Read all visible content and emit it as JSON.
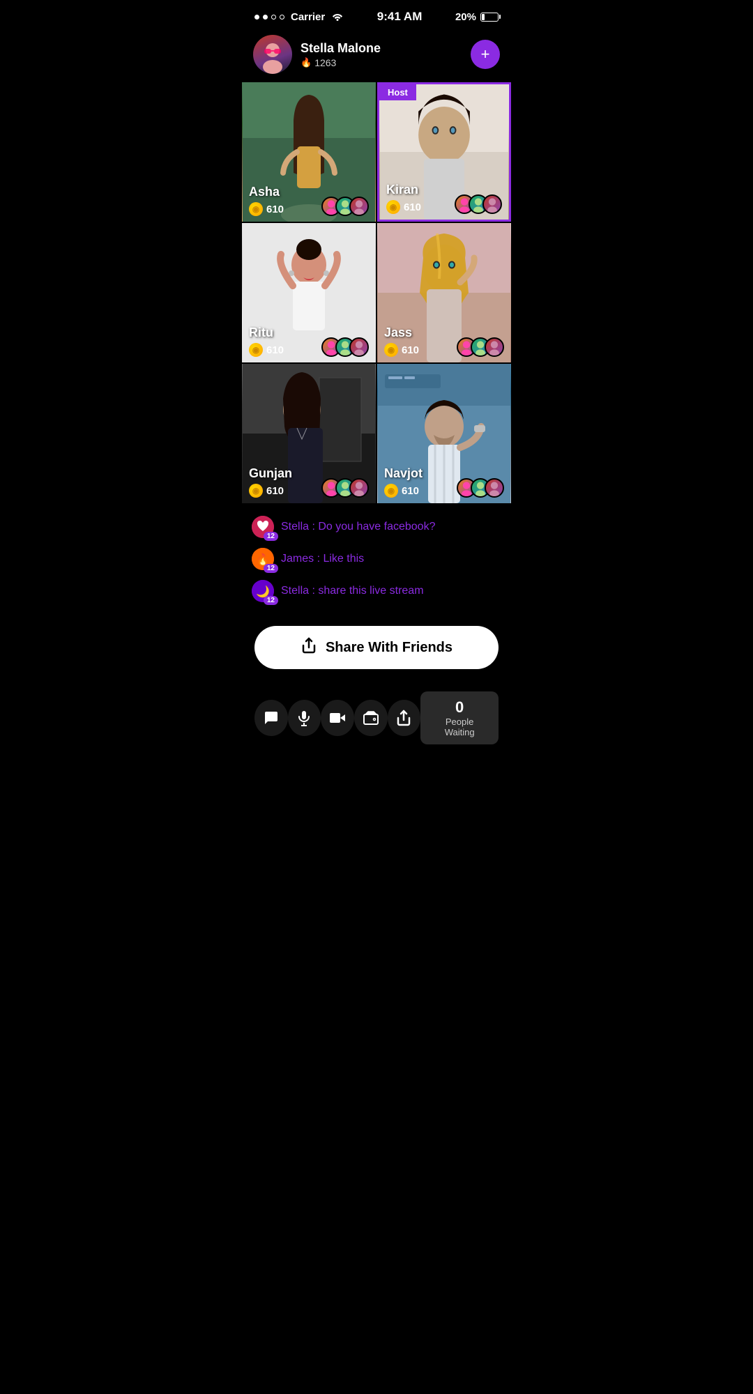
{
  "statusBar": {
    "time": "9:41 AM",
    "carrier": "Carrier",
    "battery": "20%"
  },
  "profile": {
    "name": "Stella Malone",
    "score": "1263",
    "addLabel": "+"
  },
  "grid": [
    {
      "id": "asha",
      "name": "Asha",
      "coins": "610",
      "isHost": false,
      "bgClass": "bg-asha"
    },
    {
      "id": "kiran",
      "name": "Kiran",
      "coins": "610",
      "isHost": true,
      "bgClass": "bg-kiran"
    },
    {
      "id": "ritu",
      "name": "Ritu",
      "coins": "610",
      "isHost": false,
      "bgClass": "bg-ritu"
    },
    {
      "id": "jass",
      "name": "Jass",
      "coins": "610",
      "isHost": false,
      "bgClass": "bg-jass"
    },
    {
      "id": "gunjan",
      "name": "Gunjan",
      "coins": "610",
      "isHost": false,
      "bgClass": "bg-gunjan"
    },
    {
      "id": "navjot",
      "name": "Navjot",
      "coins": "610",
      "isHost": false,
      "bgClass": "bg-navjot"
    }
  ],
  "hostLabel": "Host",
  "chat": [
    {
      "user": "Stella",
      "message": "Do you have facebook?",
      "avatarType": "heart",
      "badge": "12"
    },
    {
      "user": "James",
      "message": "Like this",
      "avatarType": "fire",
      "badge": "12"
    },
    {
      "user": "Stella",
      "message": "share this live stream",
      "avatarType": "moon",
      "badge": "12"
    }
  ],
  "shareButton": {
    "label": "Share With Friends"
  },
  "bottomBar": {
    "chatIcon": "💬",
    "micIcon": "🎤",
    "videoIcon": "🎥",
    "walletIcon": "👛",
    "shareIcon": "⬆",
    "peopleWaiting": {
      "count": "0",
      "label": "People Waiting"
    }
  }
}
